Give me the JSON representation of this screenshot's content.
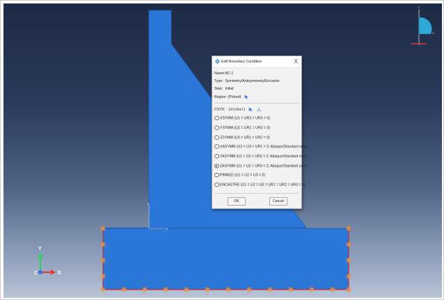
{
  "viewport": {
    "background_top": "#1d2a45",
    "background_bottom": "#b9c4d6",
    "part_color": "#2b77d8",
    "node_marker_color": "#f08a3c",
    "bc_edge_color": "#d12a2a"
  },
  "triad": {
    "y_label": "Y",
    "x_label": "X",
    "z_label": "Z"
  },
  "view_cube": {
    "y_label": "Y",
    "x_label": "X"
  },
  "local_csys": {
    "y_label": "Y",
    "x_label": "X"
  },
  "dialog": {
    "title": "Edit Boundary Condition",
    "close_glyph": "X",
    "name_label": "Name:",
    "name_value": "BC-1",
    "type_label": "Type:",
    "type_value": "Symmetry/Antisymmetry/Encastre",
    "step_label": "Step:",
    "step_value": "Initial",
    "region_label": "Region:",
    "region_value": "(Picked)",
    "csys_label": "CSYS:",
    "csys_value": "(Global)",
    "options": [
      {
        "label": "XSYMM (U1 = UR2 = UR3 = 0)",
        "selected": false
      },
      {
        "label": "YSYMM (U2 = UR1 = UR3 = 0)",
        "selected": false
      },
      {
        "label": "ZSYMM (U3 = UR1 = UR2 = 0)",
        "selected": false
      },
      {
        "label": "XASYMM (U2 = U3 = UR1 = 0; Abaqus/Standard only)",
        "selected": false
      },
      {
        "label": "YASYMM (U1 = U3 = UR2 = 0; Abaqus/Standard only)",
        "selected": false
      },
      {
        "label": "ZASYMM (U1 = U2 = UR3 = 0; Abaqus/Standard only)",
        "selected": true
      },
      {
        "label": "PINNED (U1 = U2 = U3 = 0)",
        "selected": false
      },
      {
        "label": "ENCASTRE (U1 = U2 = U3 = UR1 = UR2 = UR3 = 0)",
        "selected": false
      }
    ],
    "ok_label": "OK",
    "cancel_label": "Cancel"
  }
}
